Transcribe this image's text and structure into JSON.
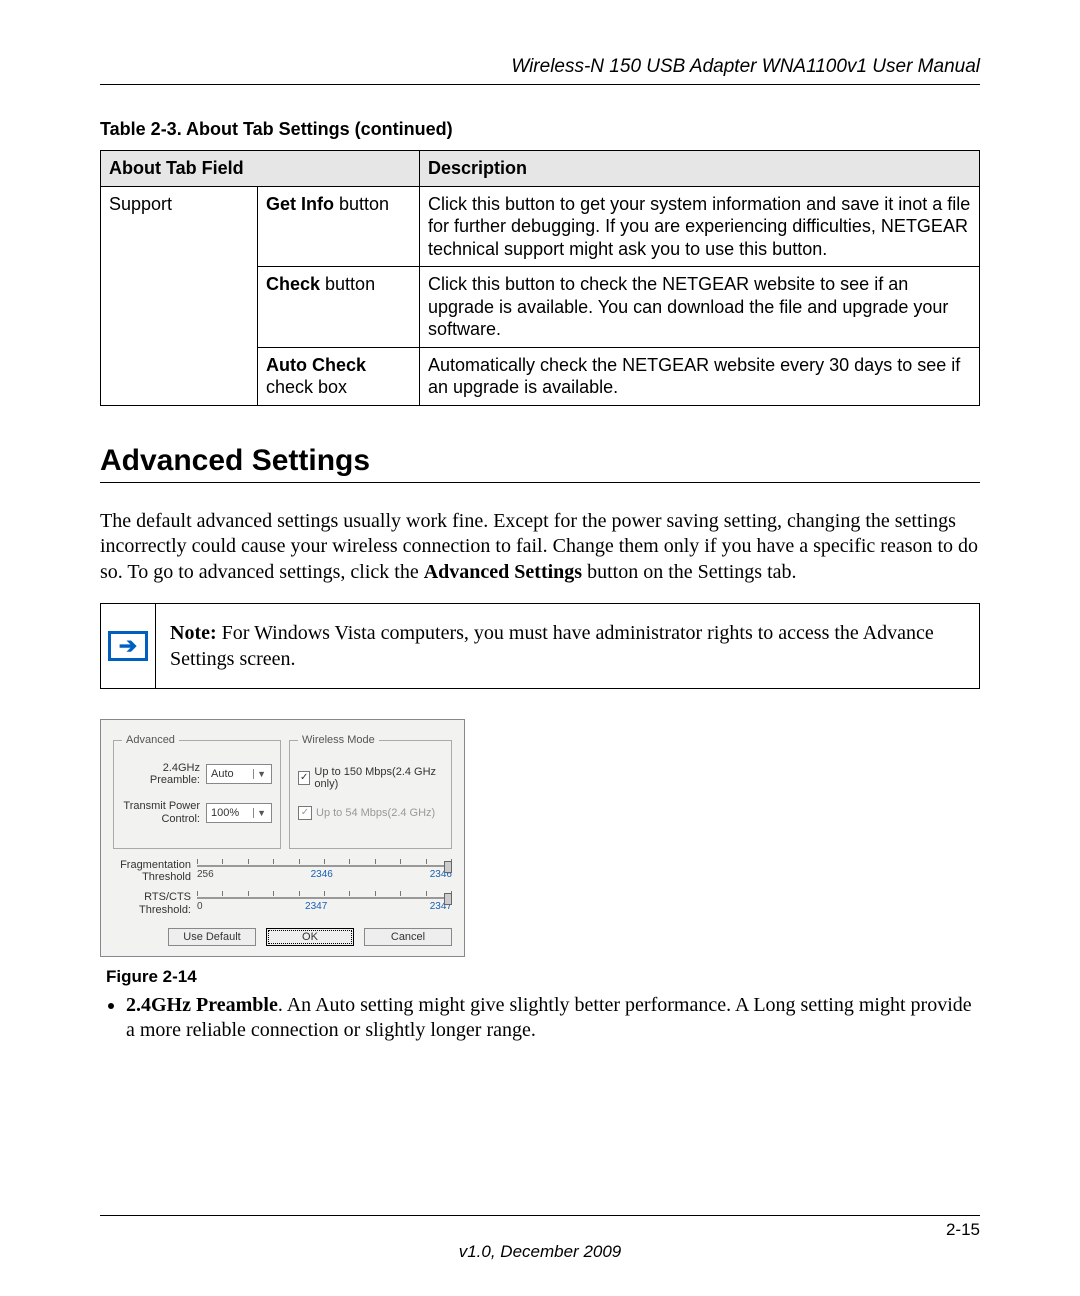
{
  "header": "Wireless-N 150 USB Adapter WNA1100v1 User Manual",
  "table_caption": "Table 2-3.  About Tab Settings  (continued)",
  "table": {
    "head_field": "About Tab Field",
    "head_desc": "Description",
    "rows": [
      {
        "cat": "Support",
        "sub_bold": "Get Info",
        "sub_rest": " button",
        "desc": "Click this button to get your system information and save it inot a file for further debugging. If you are experiencing difficulties, NETGEAR technical support might ask you to use this button."
      },
      {
        "sub_bold": "Check",
        "sub_rest": " button",
        "desc": "Click this button to check the NETGEAR website to see if an upgrade is available. You can download the file and upgrade your software."
      },
      {
        "sub_bold": "Auto Check",
        "sub_rest": " check box",
        "desc": "Automatically check the NETGEAR website every 30 days to see if an upgrade is available."
      }
    ]
  },
  "section_title": "Advanced Settings",
  "intro_para_pre": "The default advanced settings usually work fine. Except for the power saving setting, changing the settings incorrectly could cause your wireless connection to fail. Change them only if you have a specific reason to do so. To go to advanced settings, click the ",
  "intro_para_bold": "Advanced Settings",
  "intro_para_post": " button on the Settings tab.",
  "note_label": "Note:",
  "note_text": " For Windows Vista computers, you must have administrator rights to access the Advance Settings screen.",
  "dialog": {
    "group_advanced": "Advanced",
    "group_wireless": "Wireless Mode",
    "preamble_label": "2.4GHz Preamble:",
    "preamble_value": "Auto",
    "power_label": "Transmit Power Control:",
    "power_value": "100%",
    "mode150": "Up to 150 Mbps(2.4 GHz only)",
    "mode54": "Up to 54 Mbps(2.4 GHz)",
    "frag_label": "Fragmentation Threshold",
    "frag_min": "256",
    "frag_mid": "2346",
    "frag_max": "2346",
    "rts_label": "RTS/CTS Threshold:",
    "rts_min": "0",
    "rts_mid": "2347",
    "rts_max": "2347",
    "btn_default": "Use Default",
    "btn_ok": "OK",
    "btn_cancel": "Cancel"
  },
  "figure_caption": "Figure 2-14",
  "bullet_bold": "2.4GHz Preamble",
  "bullet_rest": ". An Auto setting might give slightly better performance. A Long setting might provide a more reliable connection or slightly longer range.",
  "footer_page": "2-15",
  "footer_version": "v1.0, December 2009"
}
